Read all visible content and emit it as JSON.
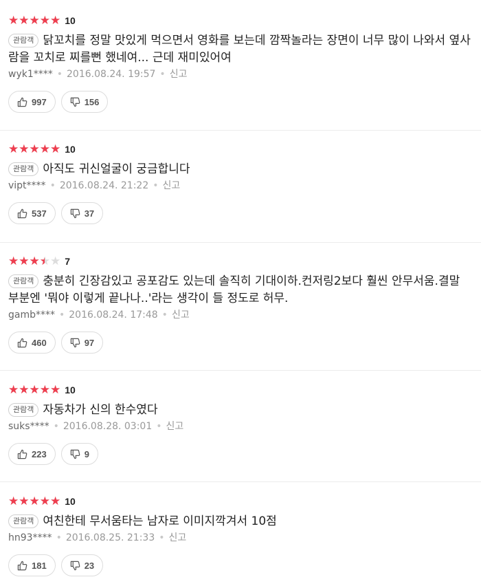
{
  "reviews": [
    {
      "stars": 5,
      "score": "10",
      "badge": "관람객",
      "comment": "닭꼬치를 정말 맛있게 먹으면서 영화를 보는데 깜짝놀라는 장면이 너무 많이 나와서 옆사람을 꼬치로 찌를뻔 했네여... 근데 재미있어여",
      "author": "wyk1****",
      "date": "2016.08.24. 19:57",
      "report": "신고",
      "likes": "997",
      "dislikes": "156"
    },
    {
      "stars": 5,
      "score": "10",
      "badge": "관람객",
      "comment": "아직도 귀신얼굴이 궁금합니다",
      "author": "vipt****",
      "date": "2016.08.24. 21:22",
      "report": "신고",
      "likes": "537",
      "dislikes": "37"
    },
    {
      "stars": 3.5,
      "score": "7",
      "badge": "관람객",
      "comment": "충분히 긴장감있고 공포감도 있는데 솔직히 기대이하.컨저링2보다 훨씬 안무서움.결말 부분엔 '뭐야 이렇게 끝나나..'라는 생각이 들 정도로 허무.",
      "author": "gamb****",
      "date": "2016.08.24. 17:48",
      "report": "신고",
      "likes": "460",
      "dislikes": "97"
    },
    {
      "stars": 5,
      "score": "10",
      "badge": "관람객",
      "comment": "자동차가 신의 한수였다",
      "author": "suks****",
      "date": "2016.08.28. 03:01",
      "report": "신고",
      "likes": "223",
      "dislikes": "9"
    },
    {
      "stars": 5,
      "score": "10",
      "badge": "관람객",
      "comment": "여친한테 무서움타는 남자로 이미지깍겨서 10점",
      "author": "hn93****",
      "date": "2016.08.25. 21:33",
      "report": "신고",
      "likes": "181",
      "dislikes": "23"
    }
  ],
  "colors": {
    "star_active": "#ee3e4f",
    "star_inactive": "#dddddd"
  },
  "icons": {
    "like": "thumbs-up-icon",
    "dislike": "thumbs-down-icon"
  }
}
